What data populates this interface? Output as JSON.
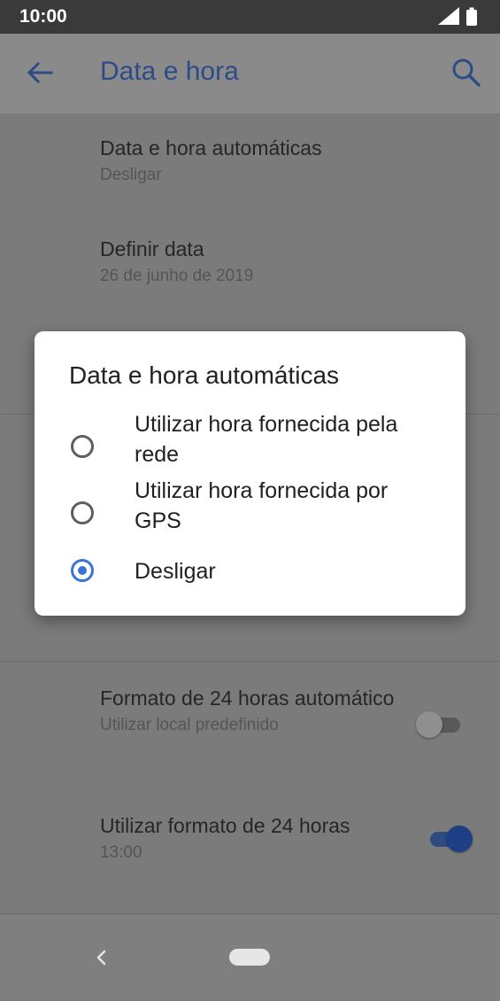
{
  "status_bar": {
    "time": "10:00"
  },
  "app_bar": {
    "title": "Data e hora"
  },
  "settings": [
    {
      "title": "Data e hora automáticas",
      "summary": "Desligar"
    },
    {
      "title": "Definir data",
      "summary": "26 de junho de 2019"
    },
    {
      "title": "Formato de 24 horas automático",
      "summary": "Utilizar local predefinido",
      "toggle_on": false
    },
    {
      "title": "Utilizar formato de 24 horas",
      "summary": "13:00",
      "toggle_on": true
    }
  ],
  "dialog": {
    "title": "Data e hora automáticas",
    "options": [
      {
        "label": "Utilizar hora fornecida pela rede",
        "checked": false
      },
      {
        "label": "Utilizar hora fornecida por GPS",
        "checked": false
      },
      {
        "label": "Desligar",
        "checked": true
      }
    ]
  },
  "colors": {
    "accent": "#3b73d6",
    "title_dimmed": "#2d4c87",
    "scrim_background": "#7b7b7b"
  }
}
